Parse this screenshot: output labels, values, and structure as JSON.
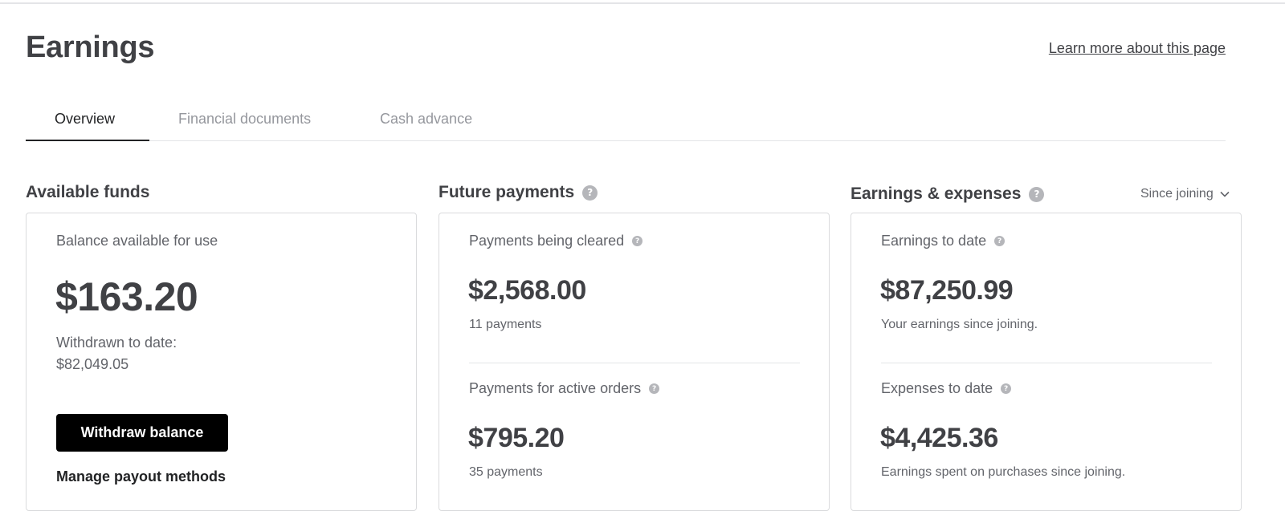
{
  "page": {
    "title": "Earnings",
    "learn_more": "Learn more about this page"
  },
  "tabs": [
    {
      "label": "Overview",
      "active": true
    },
    {
      "label": "Financial documents",
      "active": false
    },
    {
      "label": "Cash advance",
      "active": false
    }
  ],
  "available_funds": {
    "heading": "Available funds",
    "balance_label": "Balance available for use",
    "balance_value": "$163.20",
    "withdrawn_label": "Withdrawn to date:",
    "withdrawn_value": "$82,049.05",
    "withdraw_button": "Withdraw balance",
    "manage_payout": "Manage payout methods"
  },
  "future_payments": {
    "heading": "Future payments",
    "clearing_label": "Payments being cleared",
    "clearing_value": "$2,568.00",
    "clearing_count": "11 payments",
    "active_label": "Payments for active orders",
    "active_value": "$795.20",
    "active_count": "35 payments"
  },
  "earnings_expenses": {
    "heading": "Earnings & expenses",
    "period_select": "Since joining",
    "earnings_label": "Earnings to date",
    "earnings_value": "$87,250.99",
    "earnings_note": "Your earnings since joining.",
    "expenses_label": "Expenses to date",
    "expenses_value": "$4,425.36",
    "expenses_note": "Earnings spent on purchases since joining."
  },
  "icons": {
    "help": "help-circle-icon",
    "dropdown": "chevron-down-icon"
  },
  "colors": {
    "text": "#404145",
    "muted": "#62646a",
    "button": "#000000",
    "border": "#dadbdd"
  }
}
